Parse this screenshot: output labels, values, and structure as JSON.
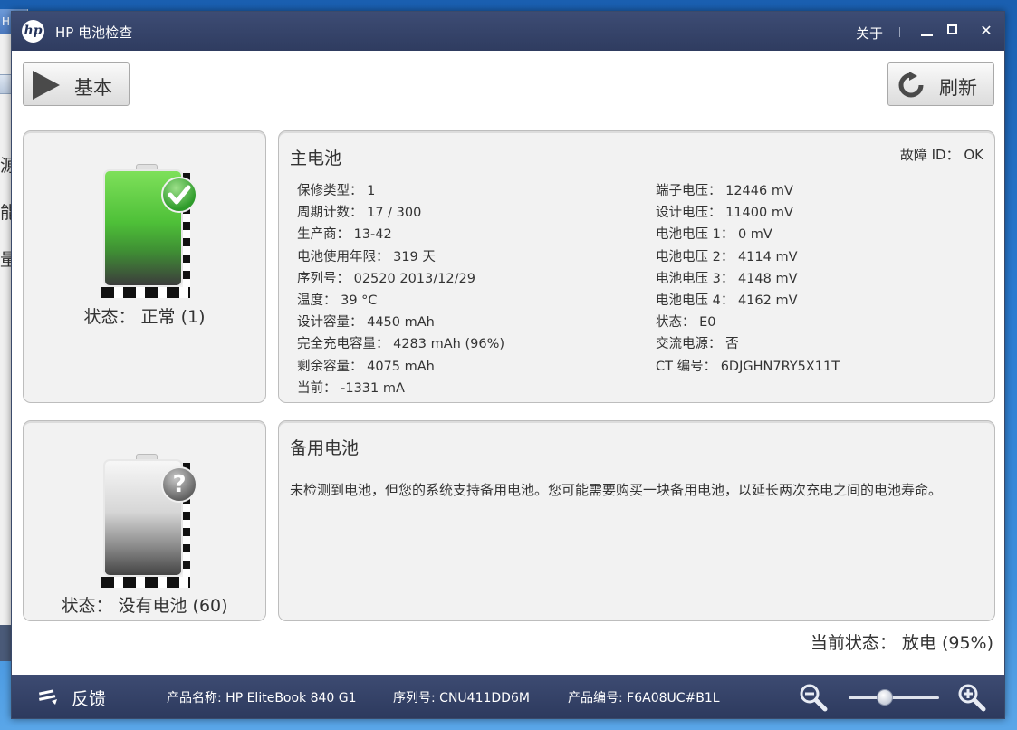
{
  "background": {
    "title_fragment": "H",
    "side_glyphs": [
      "源",
      "能",
      "量"
    ]
  },
  "window": {
    "logo": "hp",
    "title": "HP 电池检查",
    "about": "关于"
  },
  "toolbar": {
    "basic_label": "基本",
    "refresh_label": "刷新"
  },
  "main_battery": {
    "title": "主电池",
    "fault_id": "故障 ID： OK",
    "status": "状态： 正常 (1)",
    "left_rows": [
      "保修类型： 1",
      "周期计数： 17 / 300",
      "生产商： 13-42",
      "电池使用年限： 319 天",
      "序列号： 02520 2013/12/29",
      "温度： 39 °C",
      "设计容量： 4450 mAh",
      "完全充电容量： 4283 mAh (96%)",
      "剩余容量： 4075 mAh",
      "当前： -1331 mA"
    ],
    "right_rows": [
      "端子电压： 12446 mV",
      "设计电压： 11400 mV",
      "电池电压 1： 0 mV",
      "电池电压 2： 4114 mV",
      "电池电压 3： 4148 mV",
      "电池电压 4： 4162 mV",
      "状态： E0",
      "交流电源： 否",
      "CT 编号： 6DJGHN7RY5X11T"
    ]
  },
  "backup_battery": {
    "title": "备用电池",
    "status": "状态： 没有电池 (60)",
    "message": "未检测到电池，但您的系统支持备用电池。您可能需要购买一块备用电池，以延长两次充电之间的电池寿命。"
  },
  "current_status": "当前状态： 放电 (95%)",
  "footer": {
    "feedback": "反馈",
    "product_name": "产品名称: HP EliteBook 840 G1",
    "serial": "序列号: CNU411DD6M",
    "product_number": "产品编号: F6A08UC#B1L",
    "zoom_level": 0.4
  },
  "colors": {
    "titlebar": "#2f3c60",
    "battery_ok": "#4ec038",
    "panel_bg": "#f2f2f2"
  }
}
